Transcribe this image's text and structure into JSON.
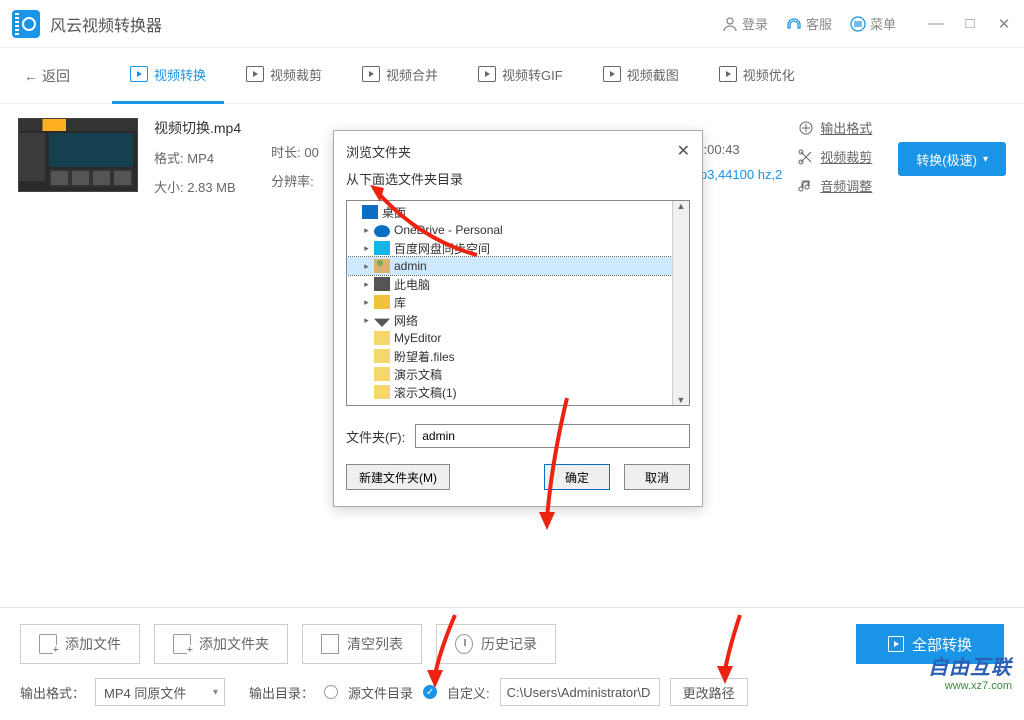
{
  "app": {
    "title": "风云视频转换器"
  },
  "header": {
    "login": "登录",
    "support": "客服",
    "menu": "菜单"
  },
  "nav": {
    "back": "返回",
    "tabs": [
      "视频转换",
      "视频裁剪",
      "视频合并",
      "视频转GIF",
      "视频截图",
      "视频优化"
    ]
  },
  "file": {
    "name": "视频切换.mp4",
    "format_label": "格式:",
    "format": "MP4",
    "size_label": "大小:",
    "size": "2.83 MB",
    "duration_label": "时长:",
    "duration_partial": "00",
    "res_label": "分辨率:",
    "duration_value": "00:00:43",
    "audio_info": "mp3,44100 hz,2"
  },
  "actions": {
    "output_format": "输出格式",
    "crop": "视频裁剪",
    "audio": "音频调整",
    "convert": "转换(极速)"
  },
  "modal": {
    "title": "浏览文件夹",
    "subtitle": "从下面选文件夹目录",
    "tree": {
      "root": "桌面",
      "items": [
        "OneDrive - Personal",
        "百度网盘同步空间",
        "admin",
        "此电脑",
        "库",
        "网络",
        "MyEditor",
        "盼望着.files",
        "演示文稿",
        "滚示文稿(1)"
      ]
    },
    "folder_label": "文件夹(F):",
    "folder_value": "admin",
    "new_folder": "新建文件夹(M)",
    "ok": "确定",
    "cancel": "取消"
  },
  "bottom": {
    "add_file": "添加文件",
    "add_folder": "添加文件夹",
    "clear": "清空列表",
    "history": "历史记录",
    "convert_all": "全部转换",
    "out_format_label": "输出格式：",
    "out_format_value": "MP4 同原文件",
    "out_dir_label": "输出目录：",
    "source_dir": "源文件目录",
    "custom": "自定义:",
    "path": "C:\\Users\\Administrator\\D",
    "change_path": "更改路径"
  },
  "watermark": {
    "brand": "自由互联",
    "url": "www.xz7.com"
  }
}
